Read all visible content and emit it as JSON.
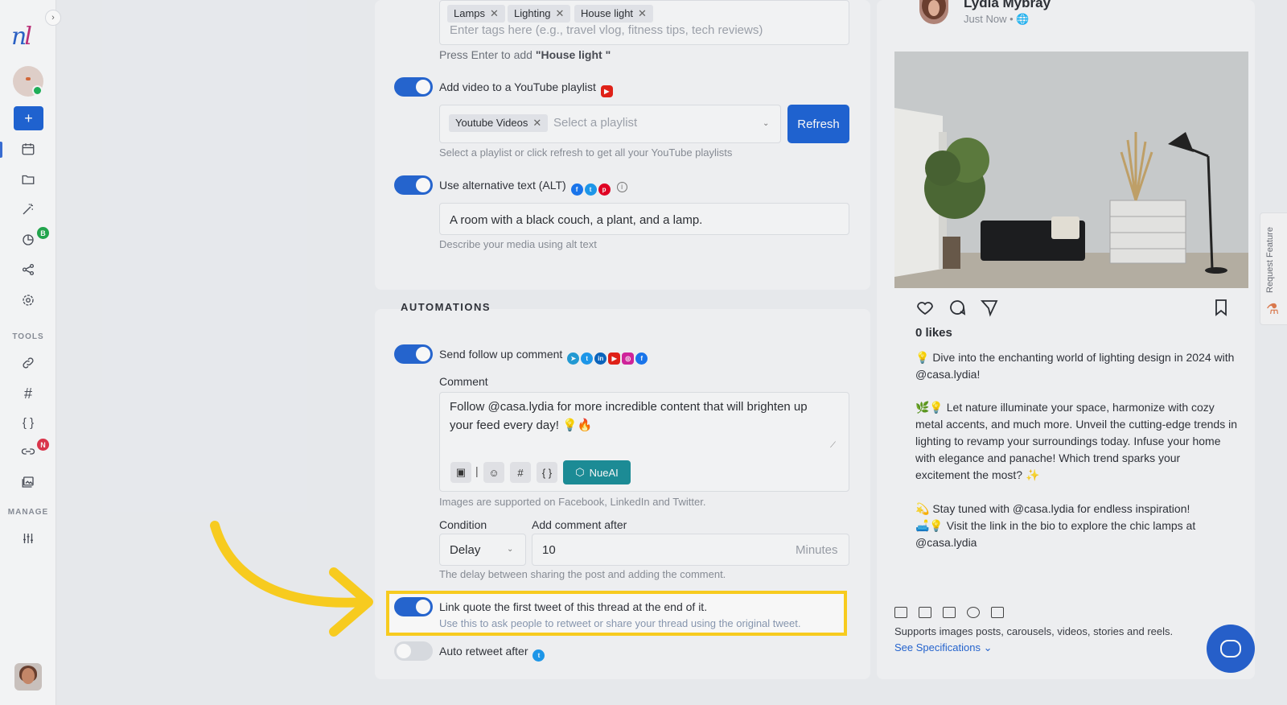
{
  "sidebar": {
    "logo": {
      "a": "n",
      "b": "l"
    },
    "sections": {
      "tools": "TOOLS",
      "manage": "MANAGE"
    },
    "badges": {
      "analytics": "B",
      "links": "N"
    },
    "plus_label": "+"
  },
  "tags": {
    "chips": [
      "Lamps",
      "Lighting",
      "House light"
    ],
    "placeholder": "Enter tags here (e.g., travel vlog, fitness tips, tech reviews)",
    "hint_prefix": "Press Enter to add ",
    "hint_value": "\"House light \""
  },
  "youtube": {
    "label": "Add video to a YouTube playlist",
    "chip": "Youtube Videos",
    "placeholder": "Select a playlist",
    "refresh": "Refresh",
    "hint": "Select a playlist or click refresh to get all your YouTube playlists"
  },
  "alt": {
    "label": "Use alternative text (ALT)",
    "value": "A room with a black couch, a plant, and a lamp.",
    "hint": "Describe your media using alt text"
  },
  "automations": {
    "title": "AUTOMATIONS",
    "followup_label": "Send follow up comment",
    "comment_label": "Comment",
    "comment_line1": "Follow @casa.lydia for more incredible content that will brighten up",
    "comment_line2": "your feed every day! 💡🔥",
    "nueai": "NueAI",
    "images_hint": "Images are supported on Facebook, LinkedIn and Twitter.",
    "condition_label": "Condition",
    "condition_value": "Delay",
    "after_label": "Add comment after",
    "after_value": "10",
    "after_unit": "Minutes",
    "delay_hint": "The delay between sharing the post and adding the comment.",
    "link_quote_label": "Link quote the first tweet of this thread at the end of it.",
    "link_quote_hint": "Use this to ask people to retweet or share your thread using the original tweet.",
    "auto_retweet_label": "Auto retweet after"
  },
  "preview": {
    "name": "Lydia Mybray",
    "sub": "Just Now • 🌐",
    "likes": "0 likes",
    "p1": "💡 Dive into the enchanting world of lighting design in 2024 with @casa.lydia!",
    "p2": "🌿💡 Let nature illuminate your space, harmonize with cozy metal accents, and much more. Unveil the cutting-edge trends in lighting to revamp your surroundings today. Infuse your home with elegance and panache! Which trend sparks your excitement the most? ✨",
    "p3": "💫 Stay tuned with @casa.lydia for endless inspiration!",
    "p4": "🛋️💡 Visit the link in the bio to explore the chic lamps at @casa.lydia",
    "supports": "Supports images posts, carousels, videos, stories and reels.",
    "spec_link": "See Specifications ⌄"
  },
  "request_feature": "Request Feature",
  "colors": {
    "primary": "#2566d4",
    "highlight": "#ffd21f",
    "teal": "#1c8f9a"
  }
}
